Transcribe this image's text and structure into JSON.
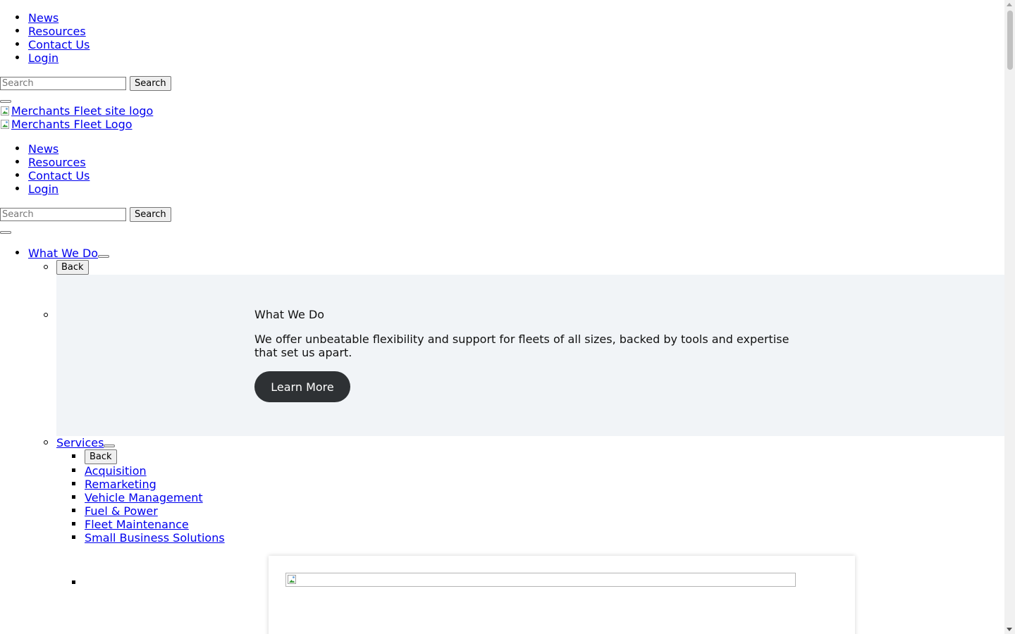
{
  "top_nav": {
    "links": [
      "News",
      "Resources",
      "Contact Us",
      "Login"
    ]
  },
  "search": {
    "placeholder": "Search",
    "button_label": "Search"
  },
  "logos": {
    "site_logo_alt": "Merchants Fleet site logo",
    "fleet_logo_alt": "Merchants Fleet Logo"
  },
  "main_nav": {
    "what_we_do": {
      "label": "What We Do",
      "back_label": "Back",
      "panel": {
        "title": "What We Do",
        "description": "We offer unbeatable flexibility and support for fleets of all sizes, backed by tools and expertise that set us apart.",
        "cta_label": "Learn More"
      }
    },
    "services": {
      "label": "Services",
      "back_label": "Back",
      "items": [
        "Acquisition",
        "Remarketing",
        "Vehicle Management",
        "Fuel & Power",
        "Fleet Maintenance",
        "Small Business Solutions"
      ]
    }
  },
  "colors": {
    "link": "#0000ee",
    "panel_bg": "#f1f4f7",
    "cta_bg": "#2e3134",
    "cta_text": "#ffffff"
  },
  "icons": {
    "broken_image": "broken-image-icon",
    "scroll_up": "scroll-up-arrow-icon",
    "scroll_down": "scroll-down-arrow-icon"
  }
}
